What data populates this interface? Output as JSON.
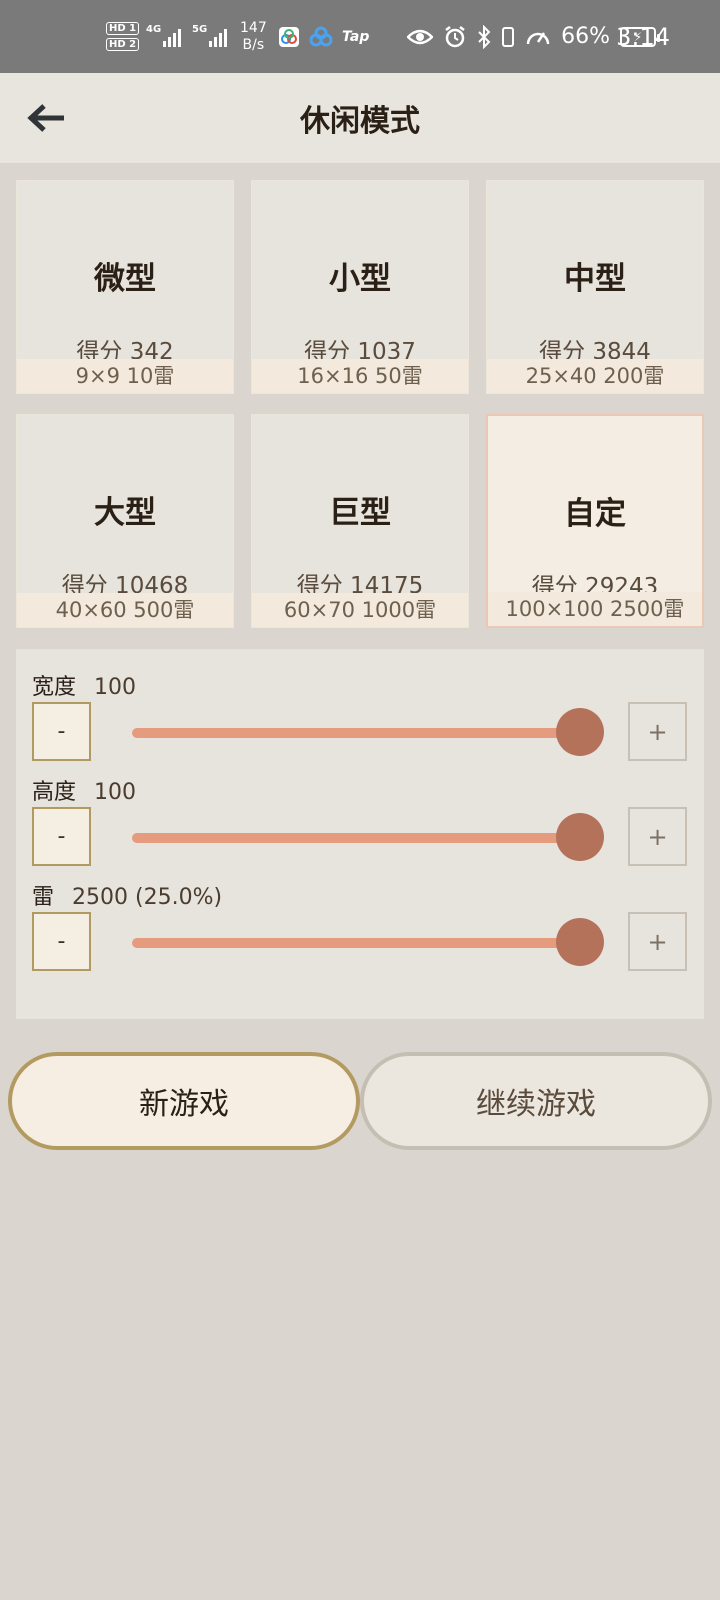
{
  "status_bar": {
    "hd1": "HD 1",
    "hd2": "HD 2",
    "net1": "4G",
    "net2": "5G",
    "speed_value": "147",
    "speed_unit": "B/s",
    "tap_label": "Tap",
    "battery_percent": "66%",
    "time": "3:14"
  },
  "header": {
    "title": "休闲模式"
  },
  "presets": [
    {
      "name": "微型",
      "score": "得分 342",
      "spec": "9×9  10雷"
    },
    {
      "name": "小型",
      "score": "得分 1037",
      "spec": "16×16  50雷"
    },
    {
      "name": "中型",
      "score": "得分 3844",
      "spec": "25×40  200雷"
    },
    {
      "name": "大型",
      "score": "得分 10468",
      "spec": "40×60  500雷"
    },
    {
      "name": "巨型",
      "score": "得分 14175",
      "spec": "60×70  1000雷"
    },
    {
      "name": "自定",
      "score": "得分 29243",
      "spec": "100×100  2500雷",
      "selected": true
    }
  ],
  "settings": {
    "width": {
      "label": "宽度",
      "value": "100",
      "level": 1.0,
      "minus": "-",
      "plus": "+"
    },
    "height": {
      "label": "高度",
      "value": "100",
      "level": 1.0,
      "minus": "-",
      "plus": "+"
    },
    "mines": {
      "label": "雷",
      "value": "2500 (25.0%)",
      "level": 1.0,
      "minus": "-",
      "plus": "+"
    }
  },
  "buttons": {
    "new_game": "新游戏",
    "continue_game": "继续游戏"
  },
  "colors": {
    "accent_track": "#e59b7e",
    "thumb": "#b5725a",
    "gold_border": "#b29a61"
  }
}
